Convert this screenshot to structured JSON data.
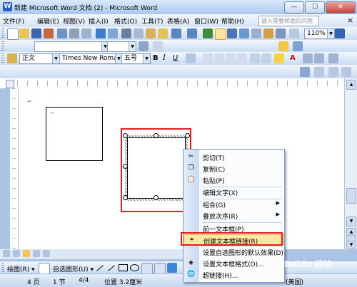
{
  "window": {
    "title": "新建 Microsoft Word 文档 (2) - Microsoft Word",
    "app_icon": "W",
    "min": "—",
    "max": "☐",
    "close": "✕"
  },
  "menu": {
    "items": [
      "文件(F)",
      "编辑(E)",
      "视图(V)",
      "插入(I)",
      "格式(O)",
      "工具(T)",
      "表格(A)",
      "窗口(W)",
      "帮助(H)"
    ],
    "help_placeholder": "键入需要帮助的问题",
    "help_close": "×"
  },
  "standard_toolbar": {
    "zoom": "110%"
  },
  "format_toolbar": {
    "style": "正文",
    "font": "Times New Roman",
    "size": "五号",
    "bold": "B",
    "italic": "I",
    "underline": "U",
    "font_color_letter": "A"
  },
  "statusbar": {
    "page": "4 页",
    "section": "1 节",
    "pages": "4/4",
    "position": "位置 3.2厘米",
    "language": "(美国)"
  },
  "drawbar": {
    "draw_label": "绘图(R) ▾",
    "autoshape_label": "自选图形(U) ▾"
  },
  "context_menu": {
    "items": [
      {
        "label": "剪切(T)",
        "icon": "scissors-icon",
        "glyph": "✂"
      },
      {
        "label": "复制(C)",
        "icon": "copy-icon",
        "glyph": "❐"
      },
      {
        "label": "粘贴(P)",
        "icon": "paste-icon",
        "glyph": "📋"
      },
      {
        "label": "编辑文字(X)",
        "icon": "",
        "glyph": ""
      },
      {
        "label": "组合(G)",
        "icon": "",
        "glyph": "",
        "submenu": true
      },
      {
        "label": "叠放次序(R)",
        "icon": "",
        "glyph": "",
        "submenu": true
      },
      {
        "label": "前一文本框(P)",
        "icon": "",
        "glyph": ""
      },
      {
        "label": "创建文本框链接(R)",
        "icon": "link-icon",
        "glyph": "⚭",
        "highlighted": true
      },
      {
        "label": "设置自选图形的默认效果(D)",
        "icon": "",
        "glyph": ""
      },
      {
        "label": "设置文本框格式(O)...",
        "icon": "format-icon",
        "glyph": "◈"
      },
      {
        "label": "超链接(H)...",
        "icon": "hyperlink-icon",
        "glyph": "🌐"
      }
    ]
  },
  "watermark": "Baidu 经验",
  "colors": {
    "highlight_fill": "#ffe7a3",
    "annotation_red": "#e02020",
    "title_gradient_top": "#d9e9fb"
  }
}
